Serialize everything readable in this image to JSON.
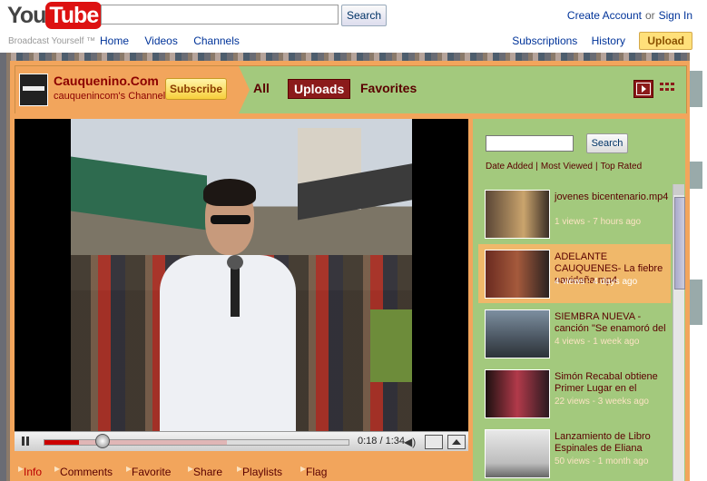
{
  "header": {
    "logo_you": "You",
    "logo_tube": "Tube",
    "tagline": "Broadcast Yourself ™",
    "search_button": "Search",
    "nav": [
      "Home",
      "Videos",
      "Channels"
    ],
    "create_account": "Create Account",
    "or": "or",
    "sign_in": "Sign In",
    "subscriptions": "Subscriptions",
    "history": "History",
    "upload": "Upload"
  },
  "channel": {
    "title": "Cauquenino.Com",
    "subtitle": "cauquenincom's Channel",
    "subscribe": "Subscribe",
    "tabs": [
      "All",
      "Uploads",
      "Favorites"
    ],
    "selected_tab": "Uploads"
  },
  "player": {
    "time": "0:18 / 1:34",
    "progress": 0.19
  },
  "bottom_tabs": [
    "Info",
    "Comments",
    "Favorite",
    "Share",
    "Playlists",
    "Flag"
  ],
  "sidebar": {
    "search_button": "Search",
    "sort": [
      "Date Added",
      "Most Viewed",
      "Top Rated"
    ],
    "videos": [
      {
        "title": "jovenes bicentenario.mp4",
        "meta": "1 views - 7 hours ago",
        "selected": false
      },
      {
        "title": "ADELANTE CAUQUENES- La fiebre navideña.mp4",
        "meta": "4 views - 4 days ago",
        "selected": true
      },
      {
        "title": "SIEMBRA NUEVA - canción \"Se enamoró del",
        "meta": "4 views - 1 week ago",
        "selected": false
      },
      {
        "title": "Simón Recabal obtiene Primer Lugar en el",
        "meta": "22 views - 3 weeks ago",
        "selected": false
      },
      {
        "title": "Lanzamiento de Libro Espinales de Eliana",
        "meta": "50 views - 1 month ago",
        "selected": false
      }
    ]
  },
  "colors": {
    "channel_orange": "#f2a55c",
    "channel_green": "#a3c97d",
    "dark_red": "#8b1a1a"
  }
}
